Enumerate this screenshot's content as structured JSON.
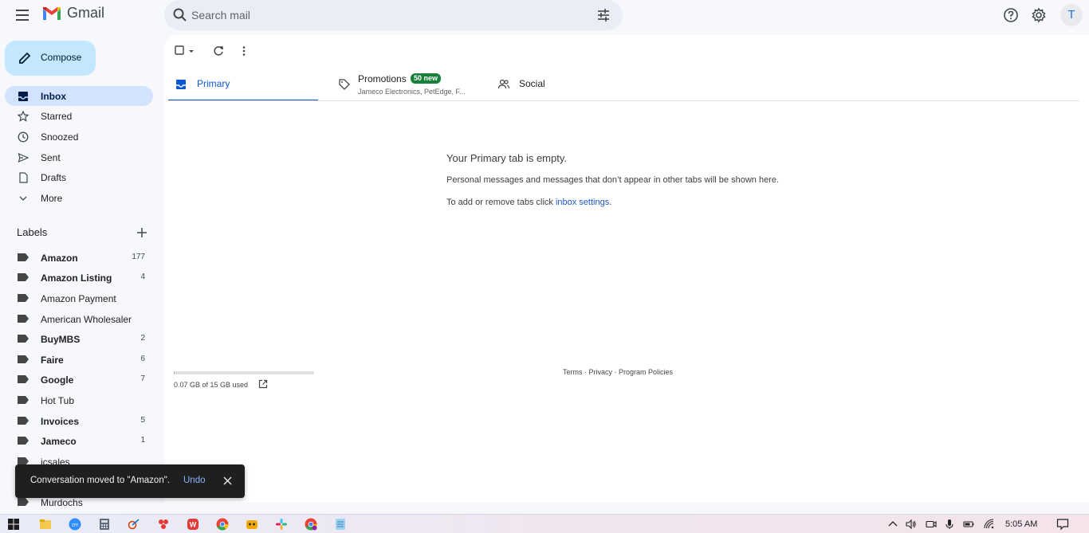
{
  "app": {
    "name": "Gmail"
  },
  "search": {
    "placeholder": "Search mail"
  },
  "header": {
    "avatar_initial": "T"
  },
  "sidebar": {
    "compose_label": "Compose",
    "nav": [
      {
        "label": "Inbox",
        "icon": "inbox-icon",
        "active": true
      },
      {
        "label": "Starred",
        "icon": "star-icon"
      },
      {
        "label": "Snoozed",
        "icon": "clock-icon"
      },
      {
        "label": "Sent",
        "icon": "send-icon"
      },
      {
        "label": "Drafts",
        "icon": "draft-icon"
      },
      {
        "label": "More",
        "icon": "chevron-down-icon"
      }
    ],
    "labels_title": "Labels",
    "labels": [
      {
        "name": "Amazon",
        "count": "177",
        "bold": true
      },
      {
        "name": "Amazon Listing",
        "count": "4",
        "bold": true
      },
      {
        "name": "Amazon Payment",
        "count": "",
        "bold": false
      },
      {
        "name": "American Wholesaler",
        "count": "",
        "bold": false
      },
      {
        "name": "BuyMBS",
        "count": "2",
        "bold": true
      },
      {
        "name": "Faire",
        "count": "6",
        "bold": true
      },
      {
        "name": "Google",
        "count": "7",
        "bold": true
      },
      {
        "name": "Hot Tub",
        "count": "",
        "bold": false
      },
      {
        "name": "Invoices",
        "count": "5",
        "bold": true
      },
      {
        "name": "Jameco",
        "count": "1",
        "bold": true
      },
      {
        "name": "jcsales",
        "count": "",
        "bold": false
      },
      {
        "name": "Murdochs",
        "count": "",
        "bold": false
      }
    ]
  },
  "tabs": {
    "primary": "Primary",
    "promotions": "Promotions",
    "promotions_badge": "50 new",
    "promotions_snippet": "Jameco Electronics, PetEdge, F...",
    "social": "Social"
  },
  "empty": {
    "title": "Your Primary tab is empty.",
    "description": "Personal messages and messages that don’t appear in other tabs will be shown here.",
    "help_prefix": "To add or remove tabs click ",
    "help_link": "inbox settings",
    "help_suffix": "."
  },
  "storage": {
    "text": "0.07 GB of 15 GB used",
    "fraction": 0.005
  },
  "footer": {
    "terms": "Terms",
    "privacy": "Privacy",
    "policies": "Program Policies",
    "sep": " · "
  },
  "toast": {
    "message": "Conversation moved to \"Amazon\".",
    "undo": "Undo"
  },
  "taskbar": {
    "time": "5:05 AM"
  },
  "colors": {
    "accent": "#0b57d0",
    "compose_bg": "#c2e7ff",
    "active_nav": "#d3e3fd",
    "badge": "#188038"
  }
}
